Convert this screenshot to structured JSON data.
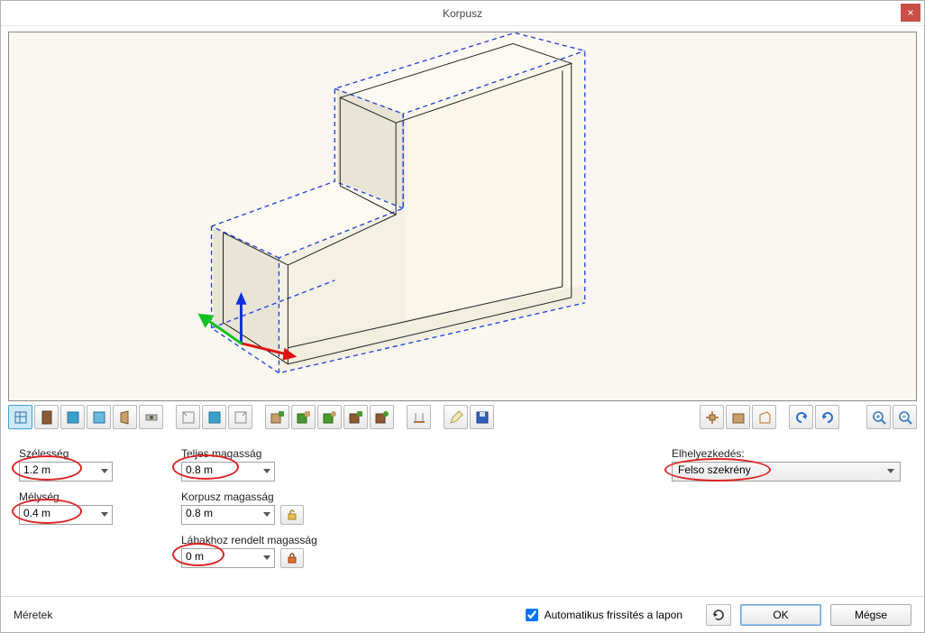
{
  "window": {
    "title": "Korpusz"
  },
  "fields": {
    "width_label": "Szélesség",
    "width_value": "1.2 m",
    "depth_label": "Mélység",
    "depth_value": "0.4 m",
    "total_height_label": "Teljes magasság",
    "total_height_value": "0.8 m",
    "carcass_height_label": "Korpusz magasság",
    "carcass_height_value": "0.8 m",
    "leg_height_label": "Lábakhoz rendelt magasság",
    "leg_height_value": "0 m",
    "placement_label": "Elhelyezkedés:",
    "placement_value": "Felso szekrény"
  },
  "footer": {
    "section_label": "Méretek",
    "auto_refresh_label": "Automatikus frissítés a lapon",
    "auto_refresh_checked": true,
    "ok_label": "OK",
    "cancel_label": "Mégse"
  },
  "icons": {
    "close": "×"
  }
}
